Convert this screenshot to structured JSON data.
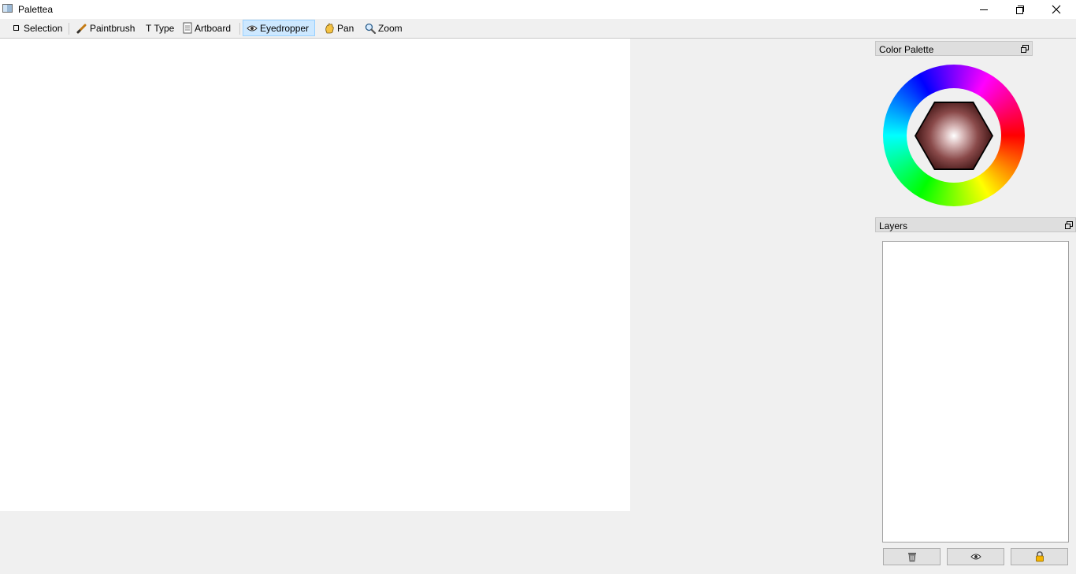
{
  "window": {
    "title": "Palettea",
    "controls": [
      "minimize-button",
      "maximize-button",
      "close-button"
    ]
  },
  "toolbar": {
    "tools": [
      {
        "label": "Selection",
        "icon": "selection-square-icon"
      },
      {
        "label": "Paintbrush",
        "icon": "paintbrush-icon"
      },
      {
        "label": "Type",
        "icon": "type-t-icon"
      },
      {
        "label": "Artboard",
        "icon": "artboard-document-icon"
      },
      {
        "label": "Eyedropper",
        "icon": "eye-icon",
        "active": true
      },
      {
        "label": "Pan",
        "icon": "hand-icon"
      },
      {
        "label": "Zoom",
        "icon": "magnifier-icon"
      }
    ],
    "type_glyph": "T"
  },
  "color_palette": {
    "title": "Color Palette",
    "wheel_hue_range": [
      0,
      360
    ],
    "selected_color": "#8a4a4a"
  },
  "layers": {
    "title": "Layers",
    "buttons": [
      {
        "icon": "trash-icon"
      },
      {
        "icon": "eye-icon"
      },
      {
        "icon": "lock-icon"
      }
    ]
  },
  "colors": {
    "active_tool_bg": "#cde8ff",
    "active_tool_border": "#99d1ff",
    "canvas": "#ffffff",
    "chrome": "#f0f0f0"
  }
}
